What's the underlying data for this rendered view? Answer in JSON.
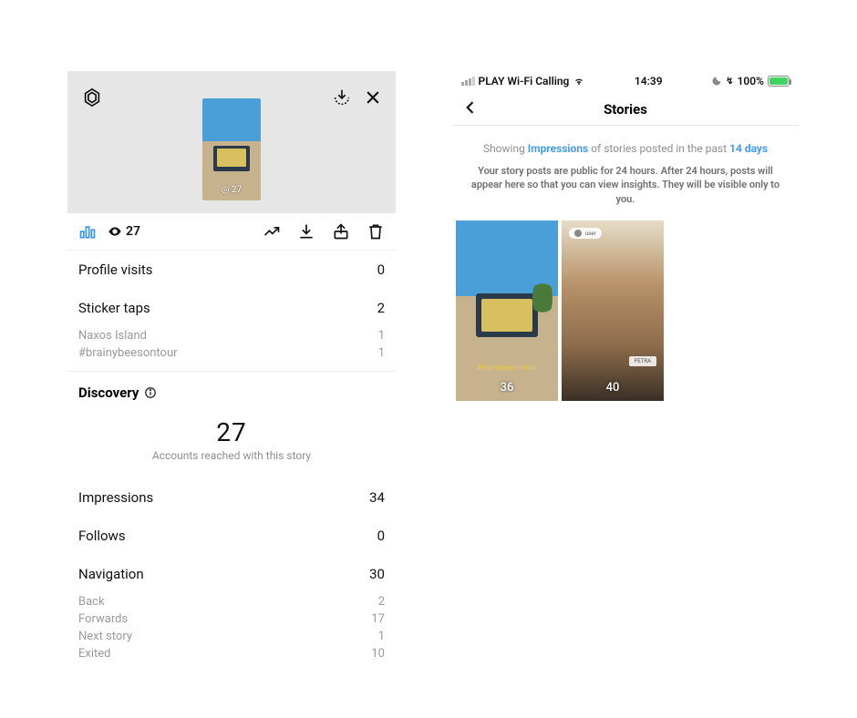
{
  "left": {
    "thumb_count": "◎ 27",
    "views_count": "27",
    "metrics": {
      "profile_visits": {
        "label": "Profile visits",
        "value": "0"
      },
      "sticker_taps": {
        "label": "Sticker taps",
        "value": "2"
      },
      "sticker_sub": [
        {
          "label": "Naxos Island",
          "value": "1"
        },
        {
          "label": "#brainybeesontour",
          "value": "1"
        }
      ]
    },
    "discovery": {
      "title": "Discovery",
      "reached_count": "27",
      "reached_label": "Accounts reached with this story",
      "impressions": {
        "label": "Impressions",
        "value": "34"
      },
      "follows": {
        "label": "Follows",
        "value": "0"
      },
      "navigation": {
        "label": "Navigation",
        "value": "30"
      },
      "nav_sub": [
        {
          "label": "Back",
          "value": "2"
        },
        {
          "label": "Forwards",
          "value": "17"
        },
        {
          "label": "Next story",
          "value": "1"
        },
        {
          "label": "Exited",
          "value": "10"
        }
      ]
    }
  },
  "right": {
    "status": {
      "carrier": "PLAY Wi-Fi Calling",
      "time": "14:39",
      "battery_pct": "100%"
    },
    "nav_title": "Stories",
    "filter": {
      "p1": "Showing ",
      "hl1": "Impressions",
      "p2": " of stories posted in the past ",
      "hl2": "14 days"
    },
    "policy": "Your story posts are public for 24 hours. After 24 hours, posts will appear here so that you can view insights. They will be visible only to you.",
    "thumbs": [
      {
        "count": "36"
      },
      {
        "count": "40"
      }
    ]
  }
}
